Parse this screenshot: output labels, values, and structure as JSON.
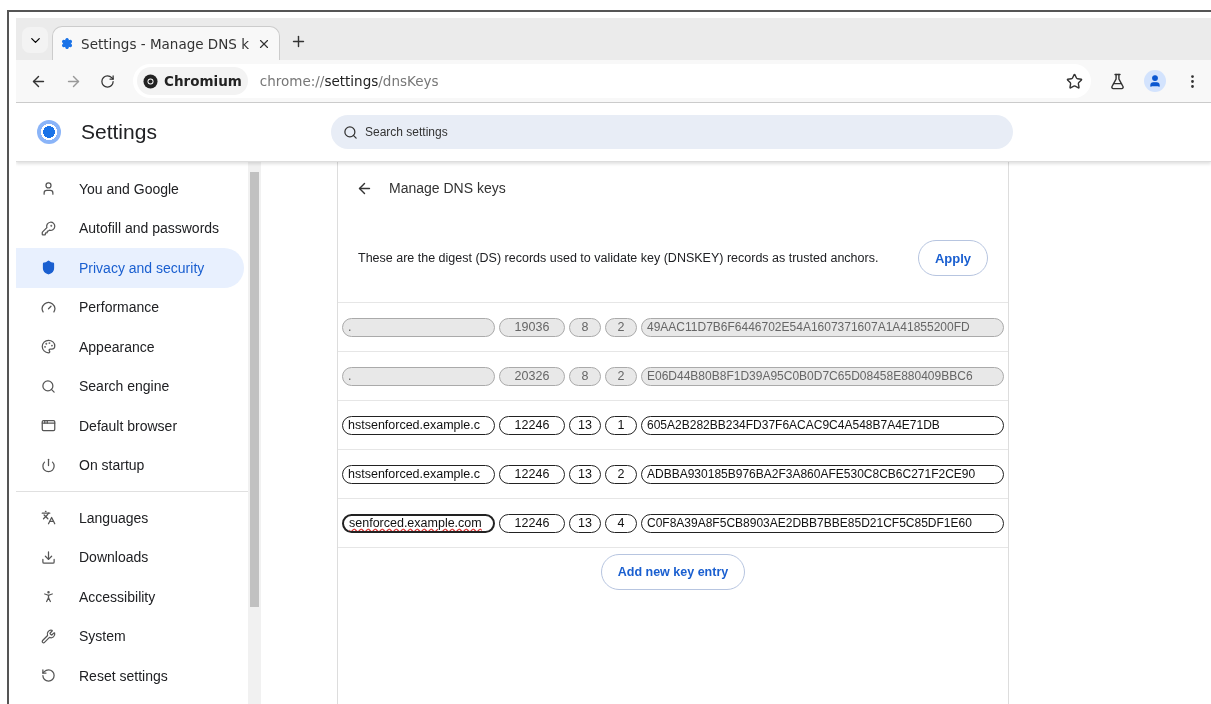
{
  "tabs": [
    {
      "title": "Settings - Manage DNS k",
      "selected": true
    }
  ],
  "toolbar": {
    "site_name": "Chromium",
    "url_scheme": "chrome://",
    "url_host": "settings",
    "url_path": "/dnsKeys"
  },
  "header": {
    "title": "Settings",
    "search_placeholder": "Search settings"
  },
  "sidebar": {
    "groups": [
      [
        {
          "label": "You and Google",
          "selected": false
        },
        {
          "label": "Autofill and passwords",
          "selected": false
        },
        {
          "label": "Privacy and security",
          "selected": true
        },
        {
          "label": "Performance",
          "selected": false
        },
        {
          "label": "Appearance",
          "selected": false
        },
        {
          "label": "Search engine",
          "selected": false
        },
        {
          "label": "Default browser",
          "selected": false
        },
        {
          "label": "On startup",
          "selected": false
        }
      ],
      [
        {
          "label": "Languages",
          "selected": false
        },
        {
          "label": "Downloads",
          "selected": false
        },
        {
          "label": "Accessibility",
          "selected": false
        },
        {
          "label": "System",
          "selected": false
        },
        {
          "label": "Reset settings",
          "selected": false
        }
      ]
    ]
  },
  "page": {
    "title": "Manage DNS keys",
    "description": "These are the digest (DS) records used to validate key (DNSKEY) records as trusted anchors.",
    "apply_button": "Apply",
    "add_button": "Add new key entry"
  },
  "entries": [
    {
      "domain": ".",
      "key_tag": "19036",
      "algorithm": "8",
      "digest_type": "2",
      "digest": "49AAC11D7B6F6446702E54A1607371607A1A41855200FD",
      "disabled": true,
      "focused": false,
      "spelling_error": false
    },
    {
      "domain": ".",
      "key_tag": "20326",
      "algorithm": "8",
      "digest_type": "2",
      "digest": "E06D44B80B8F1D39A95C0B0D7C65D08458E880409BBC6",
      "disabled": true,
      "focused": false,
      "spelling_error": false
    },
    {
      "domain": "hstsenforced.example.c",
      "key_tag": "12246",
      "algorithm": "13",
      "digest_type": "1",
      "digest": "605A2B282BB234FD37F6ACAC9C4A548B7A4E71DB",
      "disabled": false,
      "focused": false,
      "spelling_error": false
    },
    {
      "domain": "hstsenforced.example.c",
      "key_tag": "12246",
      "algorithm": "13",
      "digest_type": "2",
      "digest": "ADBBA930185B976BA2F3A860AFE530C8CB6C271F2CE90",
      "disabled": false,
      "focused": false,
      "spelling_error": false
    },
    {
      "domain": "senforced.example.com",
      "key_tag": "12246",
      "algorithm": "13",
      "digest_type": "4",
      "digest": "C0F8A39A8F5CB8903AE2DBB7BBE85D21CF5C85DF1E60",
      "disabled": false,
      "focused": true,
      "spelling_error": true
    }
  ]
}
